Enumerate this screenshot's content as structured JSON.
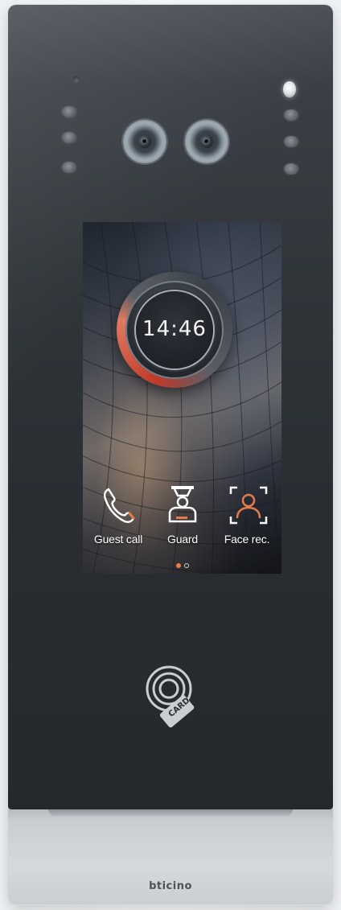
{
  "device": {
    "brand": "bticino"
  },
  "screen": {
    "clock_time": "14:46",
    "apps": [
      {
        "label": "Guest call",
        "icon": "phone-icon"
      },
      {
        "label": "Guard",
        "icon": "guard-icon"
      },
      {
        "label": "Face rec.",
        "icon": "face-recognition-icon"
      }
    ],
    "pager": {
      "active_page": 1,
      "total_pages": 2
    }
  },
  "card_reader": {
    "label": "CARD",
    "icon": "nfc-card-icon"
  },
  "colors": {
    "accent_orange": "#e77b4b",
    "ring_red": "#c0392b",
    "faceplate": "#2a2e33",
    "bottom_plate": "#d5d9dc"
  }
}
